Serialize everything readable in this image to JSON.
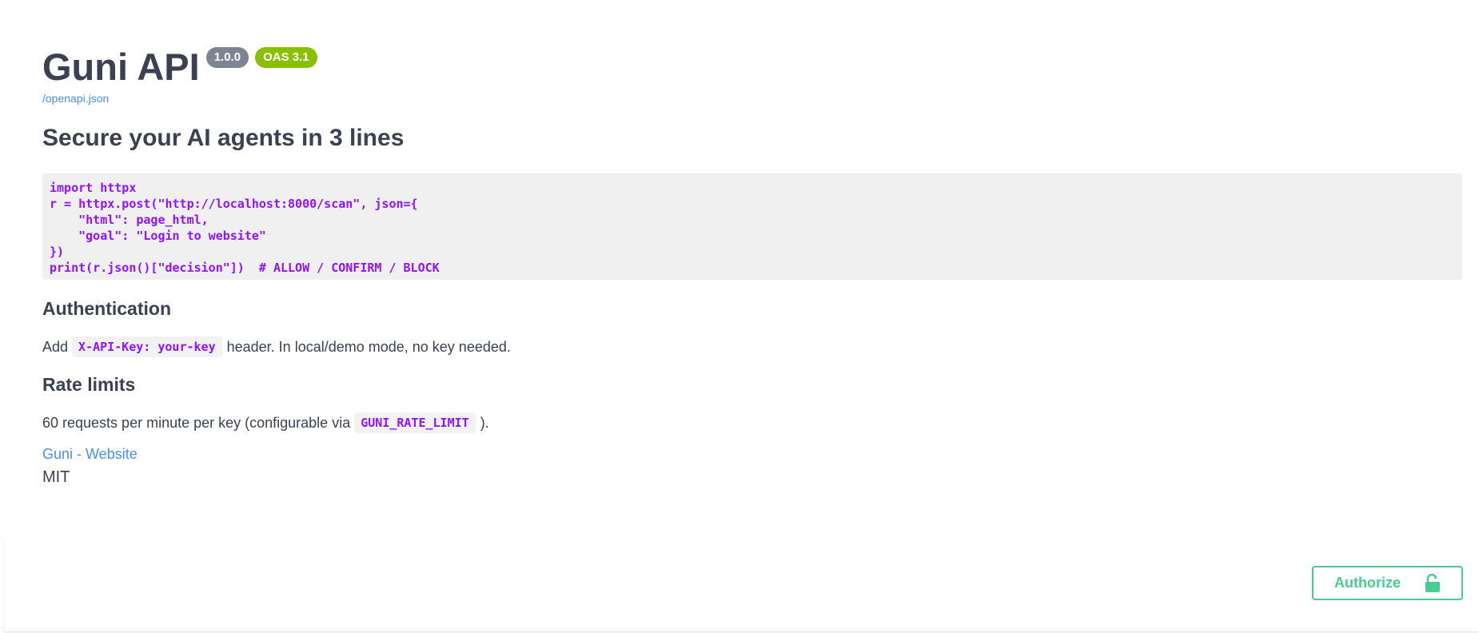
{
  "info": {
    "title": "Guni API",
    "version": "1.0.0",
    "oas": "OAS 3.1",
    "spec_url": "/openapi.json"
  },
  "description": {
    "heading": "Secure your AI agents in 3 lines",
    "code": "import httpx\nr = httpx.post(\"http://localhost:8000/scan\", json={\n    \"html\": page_html,\n    \"goal\": \"Login to website\"\n})\nprint(r.json()[\"decision\"])  # ALLOW / CONFIRM / BLOCK",
    "auth_heading": "Authentication",
    "auth_text_before": "Add",
    "auth_code": "X-API-Key: your-key",
    "auth_text_after": "header. In local/demo mode, no key needed.",
    "rate_heading": "Rate limits",
    "rate_text_before": "60 requests per minute per key (configurable via",
    "rate_code": "GUNI_RATE_LIMIT",
    "rate_text_after": ")."
  },
  "contact": {
    "website_label": "Guni - Website"
  },
  "license": {
    "name": "MIT"
  },
  "scheme": {
    "authorize_label": "Authorize",
    "icon": "lock-open-icon"
  },
  "colors": {
    "badge_version": "#7d8492",
    "badge_oas": "#89bf04",
    "link": "#4990e2",
    "code": "#9012fe",
    "authorize": "#49cc90"
  }
}
